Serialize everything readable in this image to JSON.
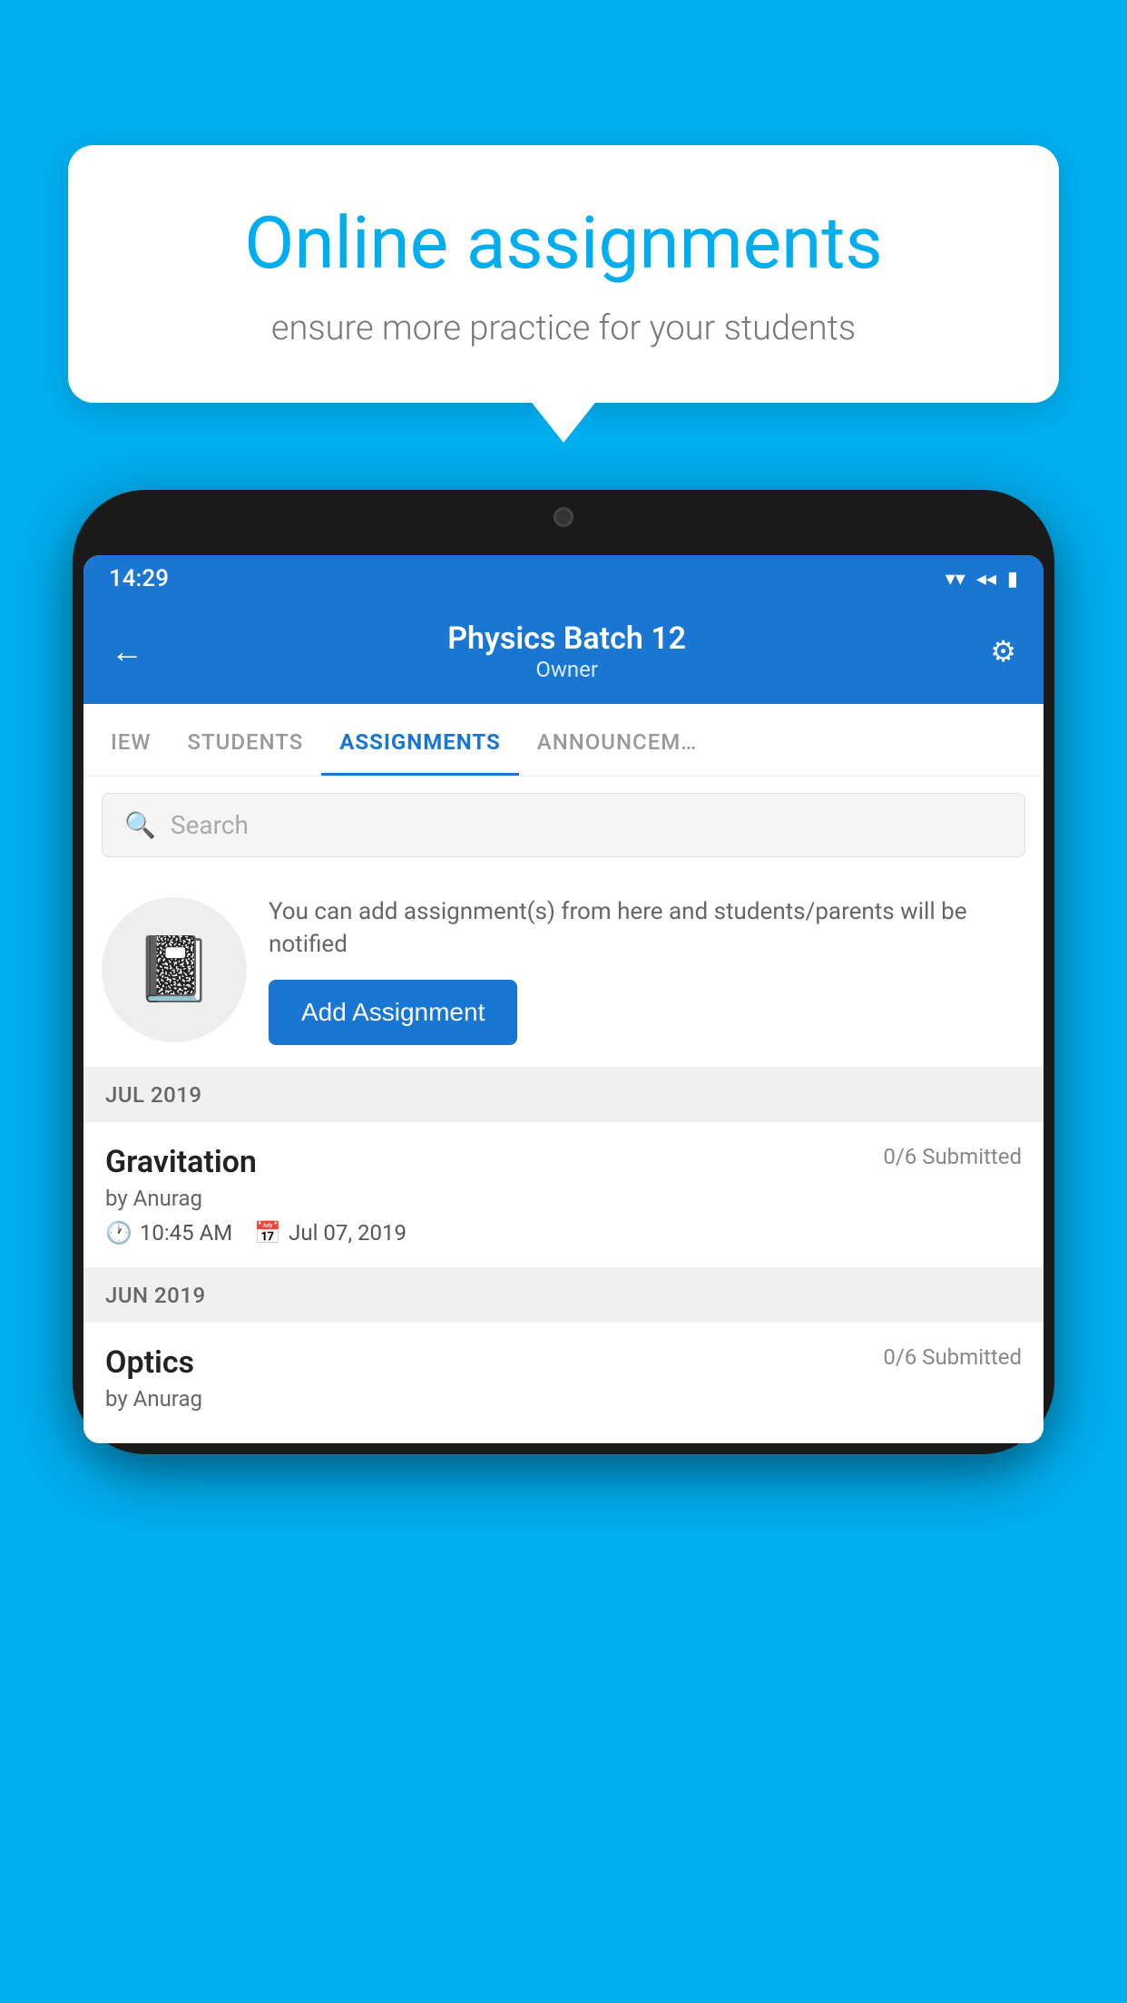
{
  "background": {
    "color": "#00AEEF"
  },
  "speech_bubble": {
    "title": "Online assignments",
    "subtitle": "ensure more practice for your students"
  },
  "phone": {
    "status_bar": {
      "time": "14:29",
      "wifi": "▼",
      "signal": "▲",
      "battery": "▮"
    },
    "header": {
      "back_label": "←",
      "title": "Physics Batch 12",
      "subtitle": "Owner",
      "settings_label": "⚙"
    },
    "tabs": [
      {
        "label": "IEW",
        "active": false
      },
      {
        "label": "STUDENTS",
        "active": false
      },
      {
        "label": "ASSIGNMENTS",
        "active": true
      },
      {
        "label": "ANNOUNCEM…",
        "active": false
      }
    ],
    "search": {
      "placeholder": "Search"
    },
    "promo": {
      "text": "You can add assignment(s) from here and students/parents will be notified",
      "button_label": "Add Assignment"
    },
    "sections": [
      {
        "month": "JUL 2019",
        "assignments": [
          {
            "name": "Gravitation",
            "submitted": "0/6 Submitted",
            "by": "by Anurag",
            "time": "10:45 AM",
            "date": "Jul 07, 2019"
          }
        ]
      },
      {
        "month": "JUN 2019",
        "assignments": [
          {
            "name": "Optics",
            "submitted": "0/6 Submitted",
            "by": "by Anurag",
            "time": "",
            "date": ""
          }
        ]
      }
    ]
  }
}
